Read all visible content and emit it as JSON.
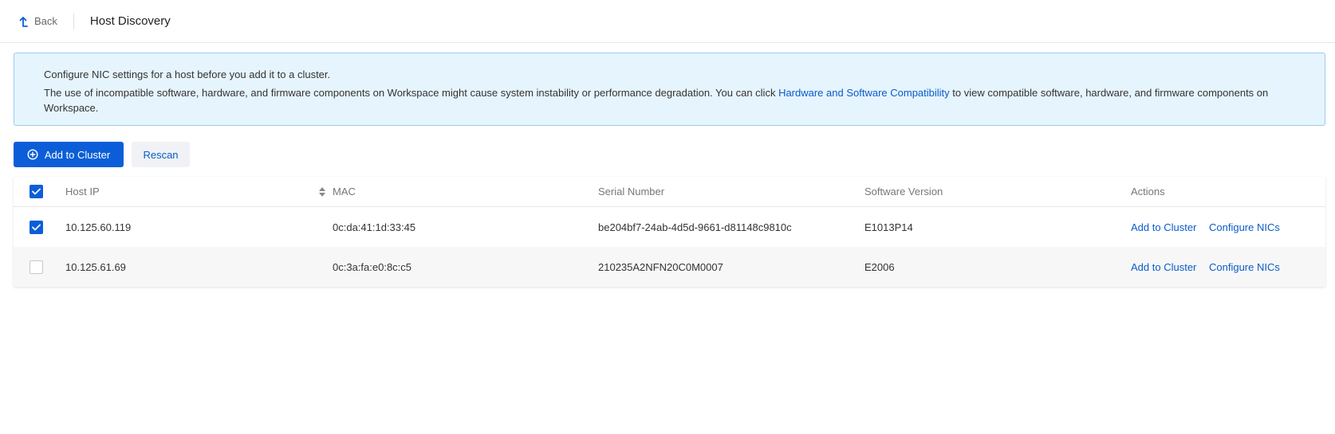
{
  "header": {
    "back_label": "Back",
    "title": "Host Discovery"
  },
  "notice": {
    "line1": "Configure NIC settings for a host before you add it to a cluster.",
    "line2_pre": "The use of incompatible software, hardware, and firmware components on Workspace might cause system instability or performance degradation. You can click ",
    "line2_link": "Hardware and Software Compatibility",
    "line2_post": " to view compatible software, hardware, and firmware components on Workspace."
  },
  "toolbar": {
    "add_label": "Add to Cluster",
    "rescan_label": "Rescan"
  },
  "table": {
    "columns": {
      "host_ip": "Host IP",
      "mac": "MAC",
      "serial": "Serial Number",
      "software": "Software Version",
      "actions": "Actions"
    },
    "rows": [
      {
        "checked": true,
        "host_ip": "10.125.60.119",
        "mac": "0c:da:41:1d:33:45",
        "serial": "be204bf7-24ab-4d5d-9661-d81148c9810c",
        "software": "E1013P14",
        "action_add": "Add to Cluster",
        "action_nics": "Configure NICs"
      },
      {
        "checked": false,
        "host_ip": "10.125.61.69",
        "mac": "0c:3a:fa:e0:8c:c5",
        "serial": "210235A2NFN20C0M0007",
        "software": "E2006",
        "action_add": "Add to Cluster",
        "action_nics": "Configure NICs"
      }
    ]
  },
  "colors": {
    "primary": "#0b5ed7",
    "link": "#0a5ccb",
    "notice_bg": "#e6f4fd",
    "notice_border": "#99cdf1"
  }
}
